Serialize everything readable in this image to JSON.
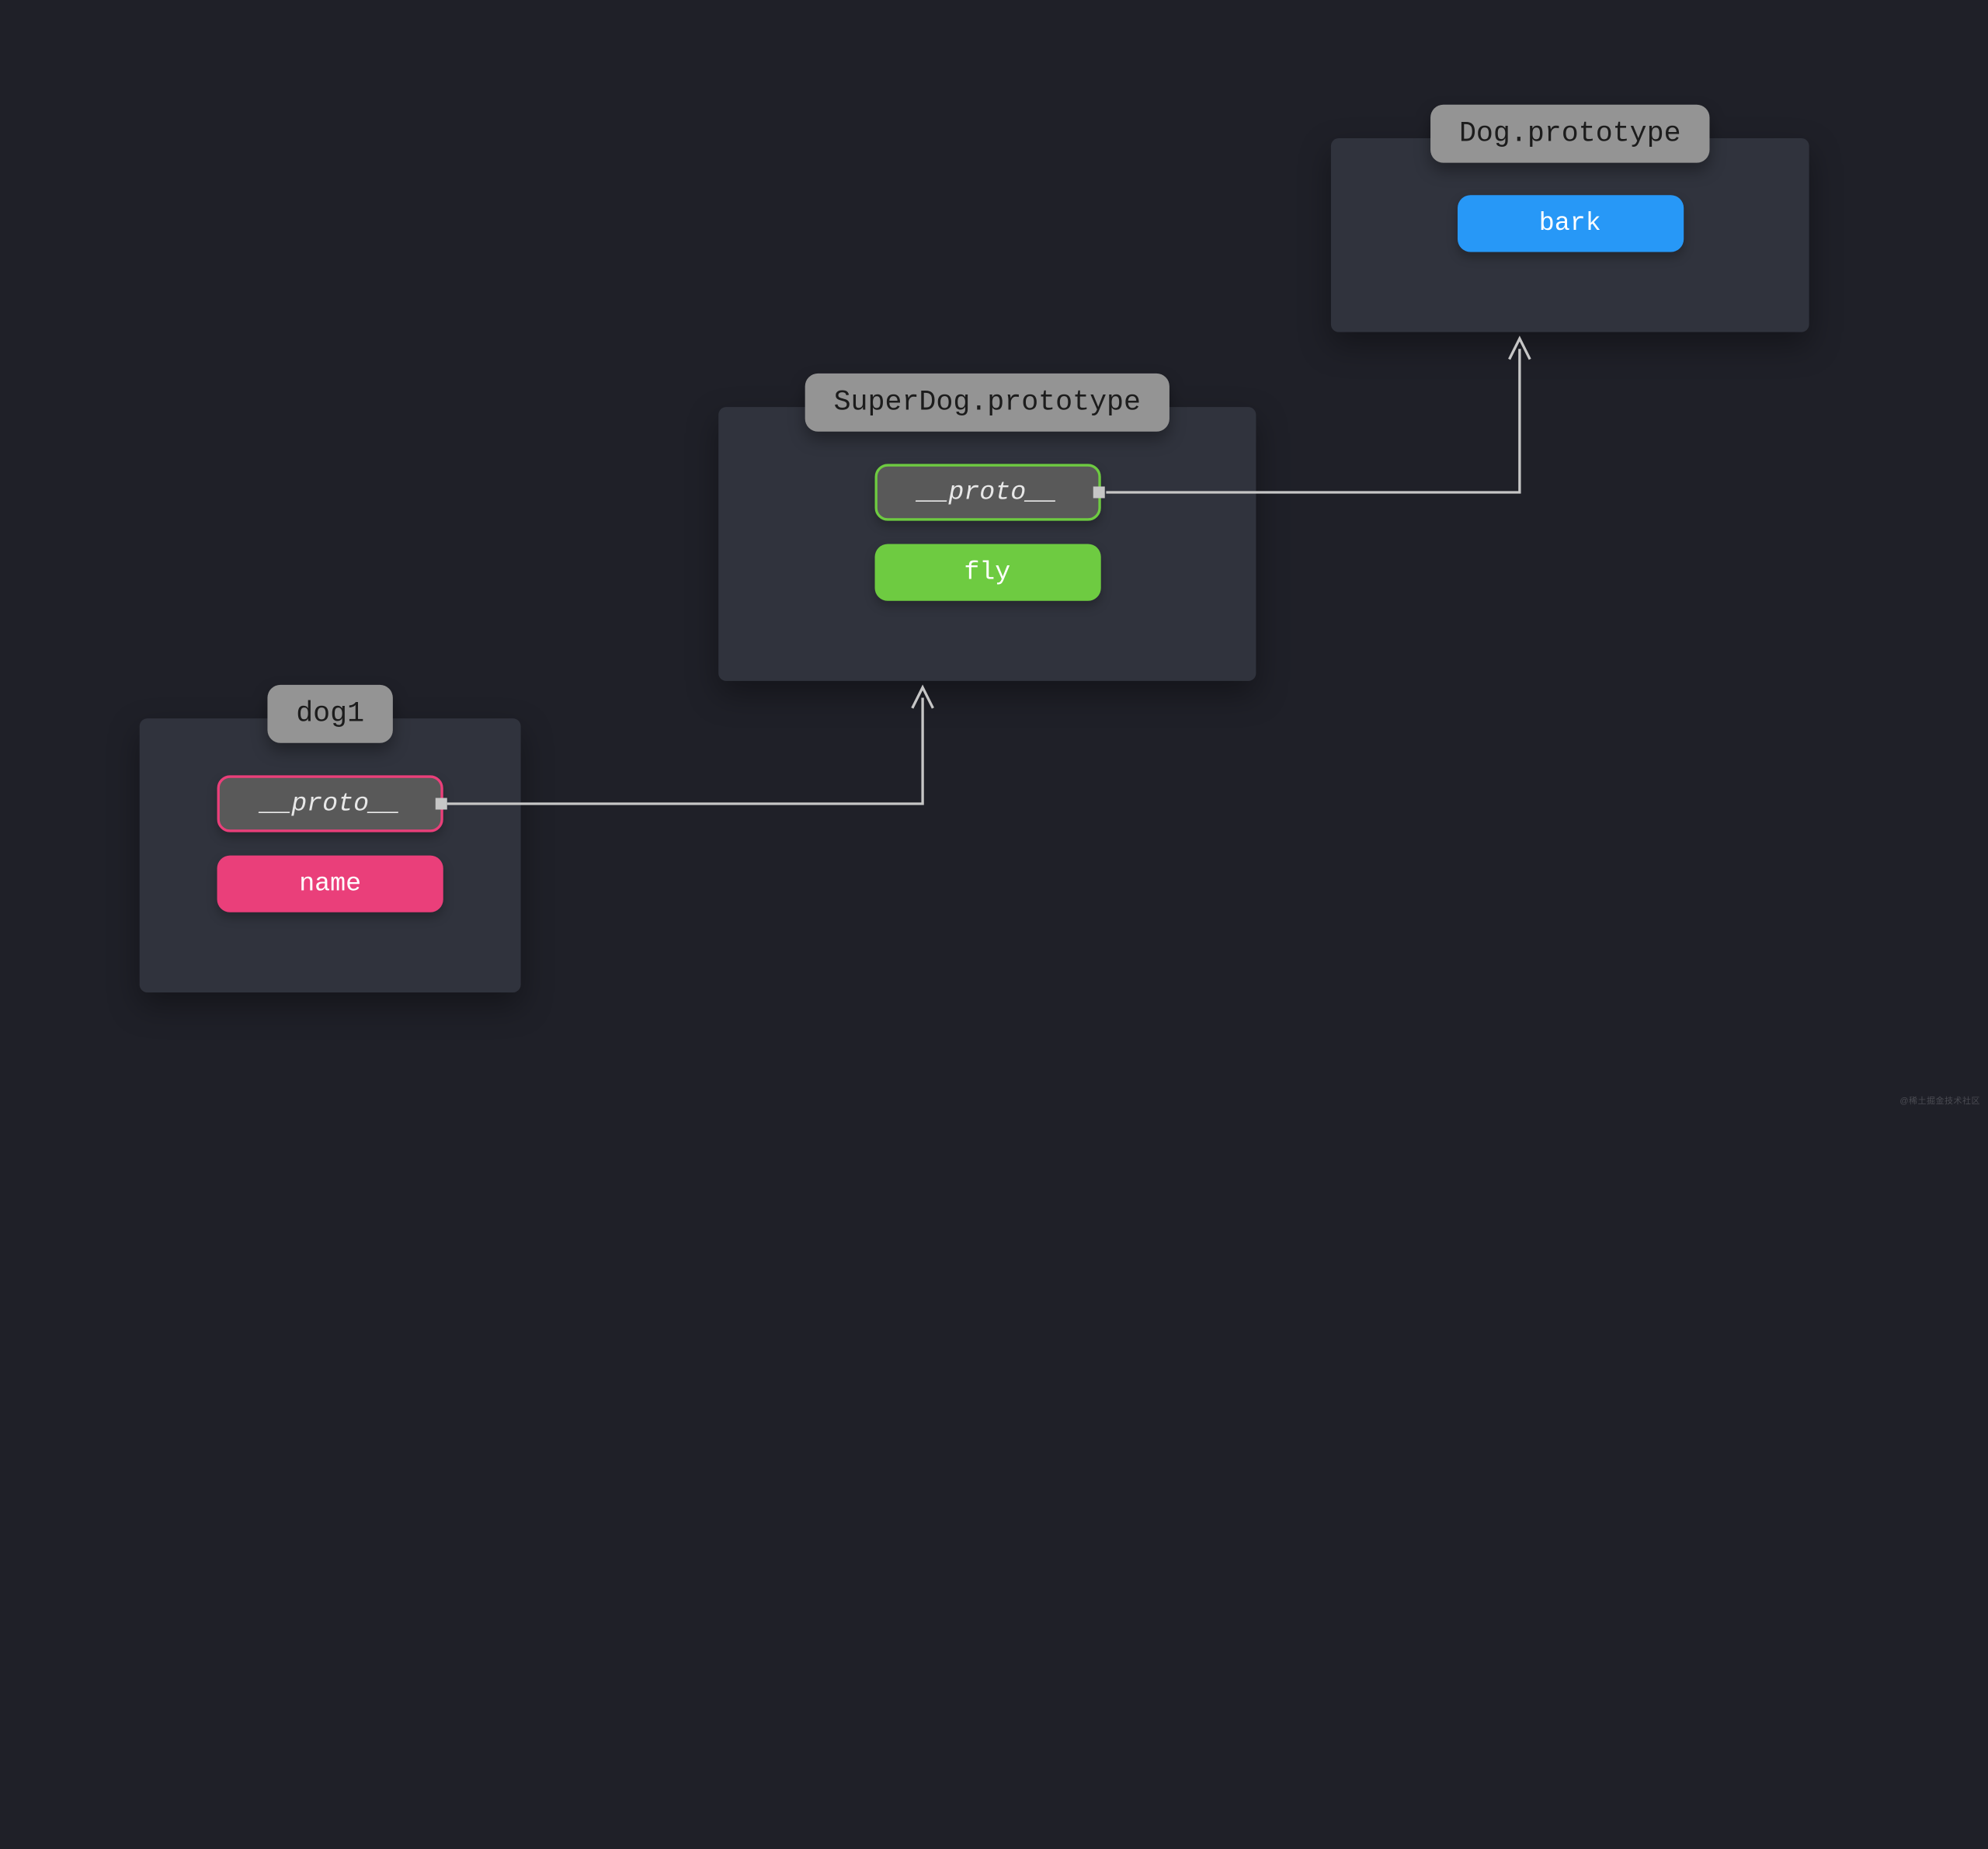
{
  "nodes": {
    "dog1": {
      "title": "dog1",
      "proto": "__proto__",
      "prop": "name"
    },
    "superdog": {
      "title": "SuperDog.prototype",
      "proto": "__proto__",
      "prop": "fly"
    },
    "dog": {
      "title": "Dog.prototype",
      "prop": "bark"
    }
  },
  "watermark": "@稀土掘金技术社区",
  "colors": {
    "pink": "#ea3f7a",
    "green": "#6ecb41",
    "blue": "#2798f7",
    "gray": "#595959"
  }
}
